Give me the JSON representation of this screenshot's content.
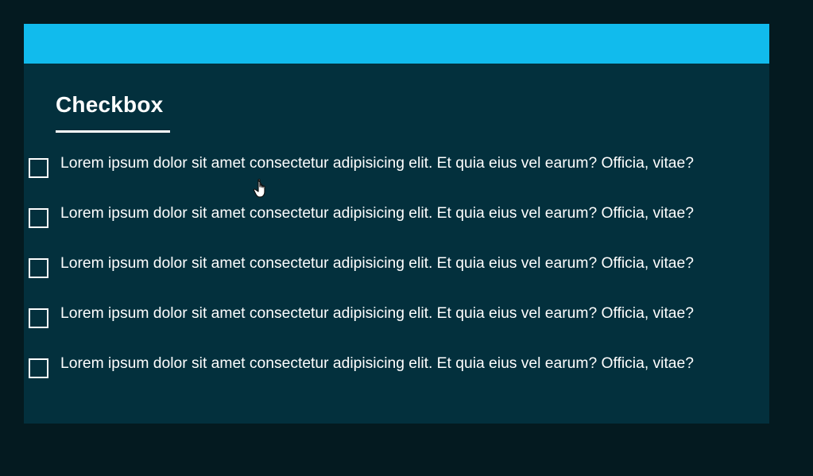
{
  "page": {
    "title": "Checkbox"
  },
  "checkbox_list": {
    "items": [
      {
        "label": "Lorem ipsum dolor sit amet consectetur adipisicing elit. Et quia eius vel earum? Officia, vitae?",
        "checked": false
      },
      {
        "label": "Lorem ipsum dolor sit amet consectetur adipisicing elit. Et quia eius vel earum? Officia, vitae?",
        "checked": false
      },
      {
        "label": "Lorem ipsum dolor sit amet consectetur adipisicing elit. Et quia eius vel earum? Officia, vitae?",
        "checked": false
      },
      {
        "label": "Lorem ipsum dolor sit amet consectetur adipisicing elit. Et quia eius vel earum? Officia, vitae?",
        "checked": false
      },
      {
        "label": "Lorem ipsum dolor sit amet consectetur adipisicing elit. Et quia eius vel earum? Officia, vitae?",
        "checked": false
      }
    ]
  },
  "icons": {
    "cursor": "hand-pointer-cursor-icon"
  },
  "colors": {
    "page_background": "#041a20",
    "card_background": "#03303d",
    "accent_bar": "#11bbed",
    "text": "#ffffff"
  }
}
